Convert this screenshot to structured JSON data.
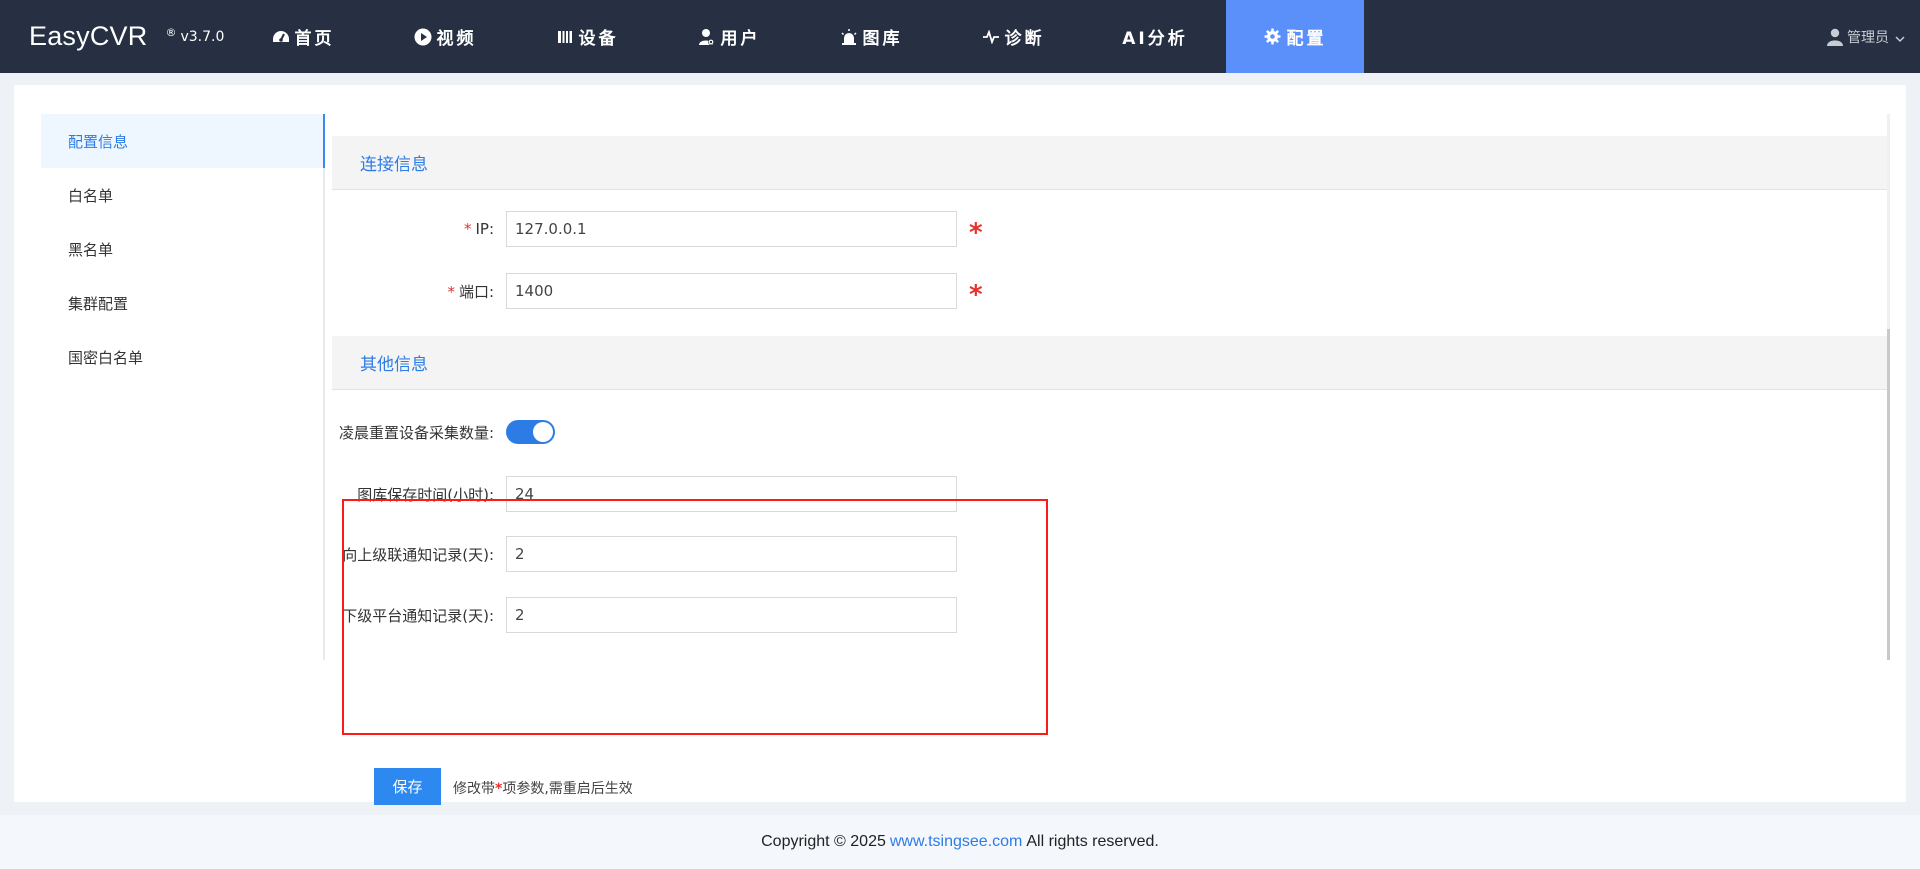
{
  "brand": {
    "name": "EasyCVR",
    "reg": "®",
    "version": "v3.7.0"
  },
  "nav": [
    {
      "label": "首页",
      "icon": "dashboard-icon"
    },
    {
      "label": "视频",
      "icon": "play-icon"
    },
    {
      "label": "设备",
      "icon": "device-icon"
    },
    {
      "label": "用户",
      "icon": "user-icon"
    },
    {
      "label": "图库",
      "icon": "alarm-icon"
    },
    {
      "label": "诊断",
      "icon": "pulse-icon"
    },
    {
      "label": "AI分析",
      "icon": ""
    },
    {
      "label": "配置",
      "icon": "gear-icon"
    }
  ],
  "user": {
    "name": "管理员"
  },
  "sidebar": {
    "items": [
      {
        "label": "配置信息"
      },
      {
        "label": "白名单"
      },
      {
        "label": "黑名单"
      },
      {
        "label": "集群配置"
      },
      {
        "label": "国密白名单"
      }
    ]
  },
  "sections": {
    "connection": "连接信息",
    "other": "其他信息"
  },
  "form": {
    "ip": {
      "label": "IP:",
      "value": "127.0.0.1"
    },
    "port": {
      "label": "端口:",
      "value": "1400"
    },
    "reset_label": "凌晨重置设备采集数量:",
    "reset_enabled": true,
    "gallery": {
      "label": "图库保存时间(小时):",
      "value": "24"
    },
    "upper": {
      "label": "向上级联通知记录(天):",
      "value": "2"
    },
    "lower": {
      "label": "下级平台通知记录(天):",
      "value": "2"
    }
  },
  "save": {
    "label": "保存",
    "note_before": "修改带",
    "note_star": "*",
    "note_after": "项参数,需重启后生效"
  },
  "footer": {
    "copyright": "Copyright © 2025",
    "link": "www.tsingsee.com",
    "rights": "All rights reserved."
  },
  "colors": {
    "navbar": "#263042",
    "accent": "#5b8ff9",
    "link": "#2d7ce6",
    "required": "#e5322d",
    "highlight": "#ff1a1a"
  }
}
